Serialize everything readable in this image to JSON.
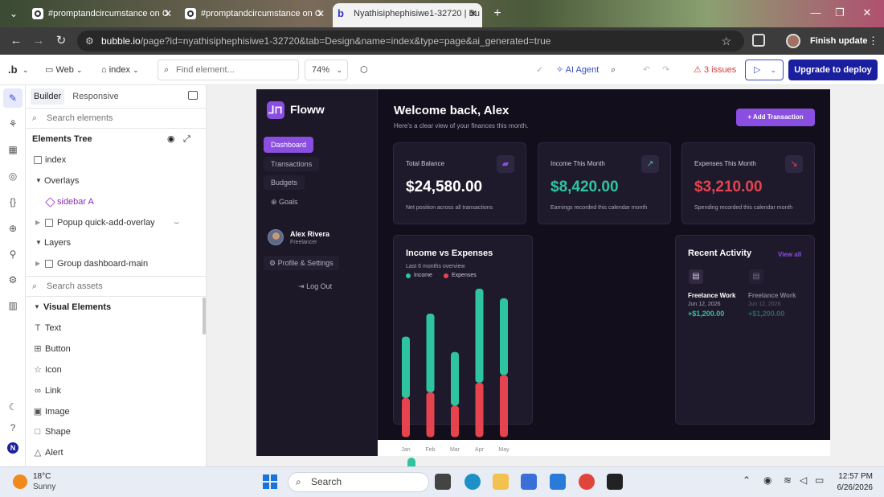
{
  "browser": {
    "tabs": [
      {
        "title": "#promptandcircumstance on C"
      },
      {
        "title": "#promptandcircumstance on C"
      },
      {
        "title": "Nyathisiphephisiwe1-32720 | Bu"
      }
    ],
    "url_host": "bubble.io",
    "url_path": "/page?id=nyathisiphephisiwe1-32720&tab=Design&name=index&type=page&ai_generated=true",
    "finish_update_label": "Finish update"
  },
  "toolbar": {
    "platform": "Web",
    "page": "index",
    "find_placeholder": "Find element...",
    "zoom": "74%",
    "ai_agent_label": "AI Agent",
    "issues_label": "3 issues",
    "deploy_label": "Upgrade to deploy"
  },
  "left_panel": {
    "tabs": [
      "Builder",
      "Responsive"
    ],
    "search_elements_placeholder": "Search elements",
    "elements_tree_title": "Elements Tree",
    "tree": {
      "index": "index",
      "overlays": "Overlays",
      "sidebar": "sidebar A",
      "popup": "Popup quick-add-overlay",
      "layers": "Layers",
      "group": "Group dashboard-main"
    },
    "search_assets_placeholder": "Search assets",
    "visual_elements_title": "Visual Elements",
    "visual_elements": [
      "Text",
      "Button",
      "Icon",
      "Link",
      "Image",
      "Shape",
      "Alert"
    ],
    "rail_avatar_initial": "N"
  },
  "app": {
    "brand": "Floww",
    "nav": [
      "Dashboard",
      "Transactions",
      "Budgets",
      "⊕ Goals"
    ],
    "user_name": "Alex Rivera",
    "user_role": "Freelancer",
    "profile_label": "⚙ Profile & Settings",
    "logout_label": "Log Out",
    "welcome": "Welcome back, Alex",
    "welcome_sub": "Here's a clear view of your finances this month.",
    "add_transaction": "+ Add Transaction",
    "stats": [
      {
        "label": "Total Balance",
        "value": "$24,580.00",
        "note": "Net position across all transactions",
        "color": "#ffffff",
        "icon": "wallet-icon"
      },
      {
        "label": "Income This Month",
        "value": "$8,420.00",
        "note": "Earnings recorded this calendar month",
        "color": "#2ec4a0",
        "icon": "trending-up-icon"
      },
      {
        "label": "Expenses This Month",
        "value": "$3,210.00",
        "note": "Spending recorded this calendar month",
        "color": "#e5444f",
        "icon": "trending-down-icon"
      }
    ],
    "recent_activity_title": "Recent Activity",
    "view_all": "View all",
    "activity": [
      {
        "name": "Freelance Work",
        "date": "Jun 12, 2026",
        "amount": "+$1,200.00"
      },
      {
        "name": "Freelance Work",
        "date": "Jun 12, 2026",
        "amount": "+$1,200.00"
      }
    ]
  },
  "chart_data": {
    "type": "bar",
    "title": "Income vs Expenses",
    "subtitle": "Last 6 months overview",
    "categories": [
      "Jan",
      "Feb",
      "Mar",
      "Apr",
      "May"
    ],
    "series": [
      {
        "name": "Income",
        "values": [
          3200,
          4100,
          2800,
          4900,
          4000
        ],
        "color": "#2ec4a0"
      },
      {
        "name": "Expenses",
        "values": [
          2100,
          2400,
          1700,
          2900,
          3300
        ],
        "color": "#e5444f"
      }
    ],
    "stacked": true,
    "legend": "top-left",
    "grid": false
  },
  "taskbar": {
    "temp": "18°C",
    "condition": "Sunny",
    "search_label": "Search",
    "time": "12:57 PM",
    "date": "6/26/2026"
  },
  "colors": {
    "accent": "#8a4ee0",
    "income": "#2ec4a0",
    "expense": "#e5444f",
    "bubble_blue": "#1a1fa0"
  }
}
